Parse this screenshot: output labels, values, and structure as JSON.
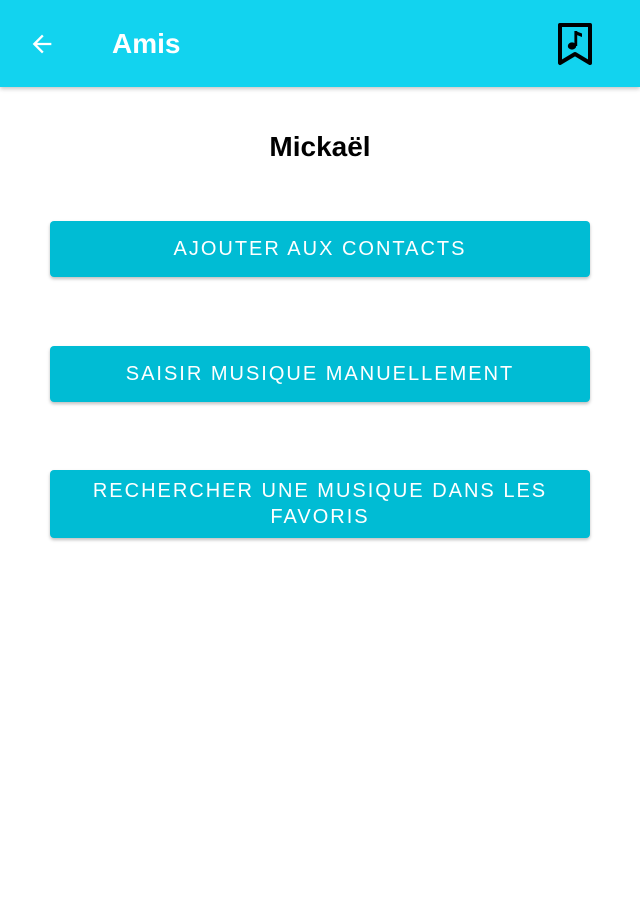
{
  "app_bar": {
    "title": "Amis",
    "back_icon": "arrow-back-icon",
    "bookmark_icon": "music-bookmark-icon",
    "color": "#12d3ef"
  },
  "friend": {
    "name": "Mickaël"
  },
  "actions": [
    {
      "label": "AJOUTER AUX CONTACTS"
    },
    {
      "label": "SAISIR MUSIQUE MANUELLEMENT"
    },
    {
      "label": "RECHERCHER UNE MUSIQUE DANS LES FAVORIS"
    }
  ],
  "colors": {
    "button": "#00bcd4",
    "button_text": "#ffffff"
  }
}
